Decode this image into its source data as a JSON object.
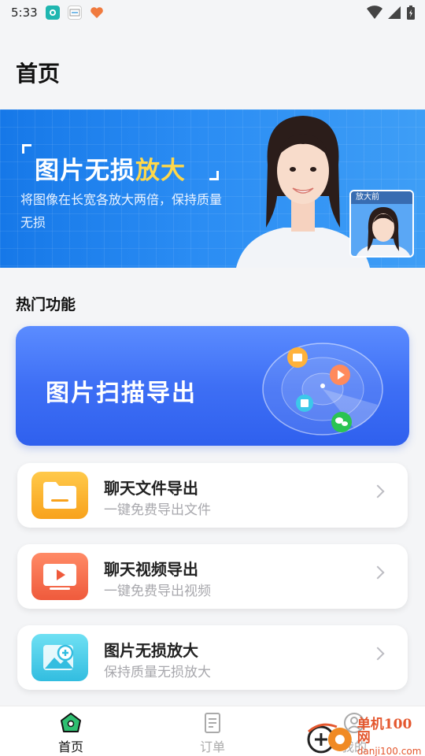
{
  "status_bar": {
    "time": "5:33"
  },
  "header": {
    "title": "首页"
  },
  "banner": {
    "title_main": "图片无损",
    "title_highlight": "放大",
    "subtitle": "将图像在长宽各放大两倍，保持质量无损",
    "thumb_label": "放大前"
  },
  "hot": {
    "section_title": "热门功能",
    "feature_label": "图片扫描导出"
  },
  "list": [
    {
      "title": "聊天文件导出",
      "subtitle": "一键免费导出文件",
      "color": "#fbb330"
    },
    {
      "title": "聊天视频导出",
      "subtitle": "一键免费导出视频",
      "color": "#f36a4c"
    },
    {
      "title": "图片无损放大",
      "subtitle": "保持质量无损放大",
      "color": "#3cc3e3"
    }
  ],
  "tabbar": {
    "home": "首页",
    "orders": "订单",
    "mine": "我的"
  },
  "watermark": {
    "main": "单机100网",
    "sub": "danji100.com"
  },
  "colors": {
    "accent": "#2f60ee",
    "banner": "#1678e8",
    "active_tab": "#111111",
    "inactive_tab": "#aaaaaa"
  }
}
